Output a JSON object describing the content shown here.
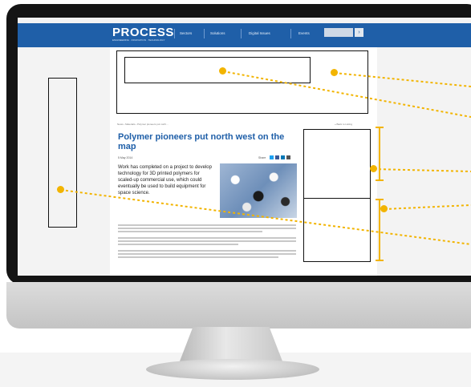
{
  "site": {
    "logo": "PROCESS",
    "tagline": "ENGINEERING · INNOVATION · TECHNOLOGY",
    "nav": [
      "Sectors",
      "Solutions",
      "Digital Issues",
      "Events"
    ],
    "search_placeholder": "",
    "search_button": "›"
  },
  "article": {
    "breadcrumb": "News › Materials › Polymer pioneers put north...",
    "breadcrumb_right": "« Back to Listing",
    "title": "Polymer pioneers put north west on the map",
    "date": "5 May 2014",
    "share_label": "Share",
    "intro": "Work has completed on a project to develop technology for 3D printed polymers for scaled-up commercial use, which could eventually be used to build equipment for space science."
  },
  "colors": {
    "brand_blue": "#1f5fa8",
    "annotation_yellow": "#f2b400",
    "outline": "#111111"
  }
}
